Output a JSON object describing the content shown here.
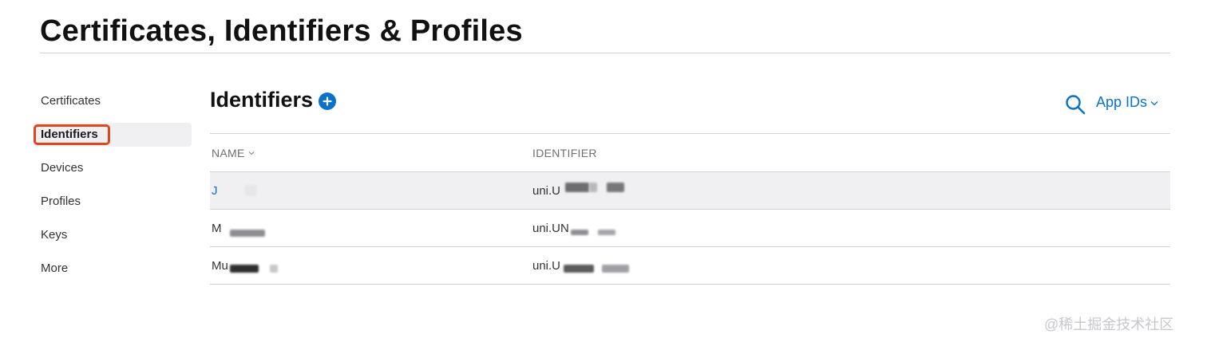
{
  "header": {
    "title": "Certificates, Identifiers & Profiles"
  },
  "sidebar": {
    "items": [
      {
        "label": "Certificates"
      },
      {
        "label": "Identifiers"
      },
      {
        "label": "Devices"
      },
      {
        "label": "Profiles"
      },
      {
        "label": "Keys"
      },
      {
        "label": "More"
      }
    ],
    "active_item": "Identifiers",
    "highlight_color": "#e0471e"
  },
  "main": {
    "section_title": "Identifiers",
    "add_icon": "plus-circle-icon",
    "search_icon": "search-icon",
    "filter": {
      "selected": "App IDs",
      "icon": "chevron-down-icon"
    },
    "table": {
      "columns": [
        "NAME",
        "IDENTIFIER"
      ],
      "sort_icon": "chevron-down-icon",
      "rows": [
        {
          "name": "J",
          "identifier": "uni.U"
        },
        {
          "name": "M",
          "identifier": "uni.UN"
        },
        {
          "name": "Mu",
          "identifier": "uni.U"
        }
      ]
    }
  },
  "watermark": "@稀土掘金技术社区",
  "colors": {
    "accent": "#0a72c9",
    "selected_row": "#f0f0f2",
    "divider": "#d2d2d7"
  }
}
